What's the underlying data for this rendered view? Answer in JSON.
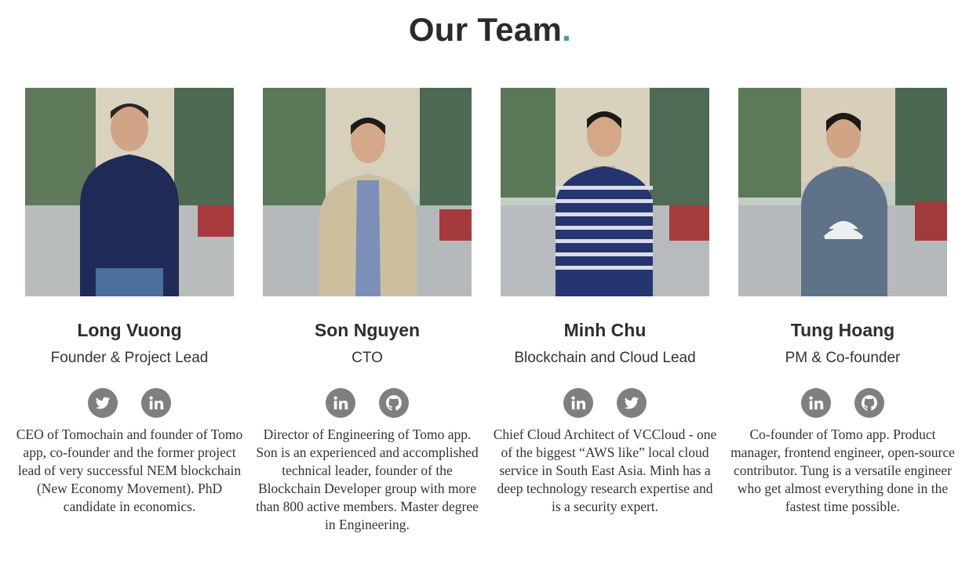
{
  "page": {
    "title": "Our Team",
    "title_dot": ".",
    "accent": "#3aa3a4"
  },
  "members": [
    {
      "name": "Long Vuong",
      "role": "Founder & Project Lead",
      "socials": [
        "twitter-icon",
        "linkedin-icon"
      ],
      "bio": "CEO of Tomochain and founder of Tomo app, co-founder and the former project lead of very successful NEM blockchain (New Economy Movement). PhD candidate in economics."
    },
    {
      "name": "Son Nguyen",
      "role": "CTO",
      "socials": [
        "linkedin-icon",
        "github-icon"
      ],
      "bio": "Director of Engineering of Tomo app. Son is an experienced and accomplished technical leader, founder of the Blockchain Developer group with more than 800 active members. Master degree in Engineering."
    },
    {
      "name": "Minh Chu",
      "role": "Blockchain and Cloud Lead",
      "socials": [
        "linkedin-icon",
        "twitter-icon"
      ],
      "bio": "Chief Cloud Architect of VCCloud - one of the biggest “AWS like” local cloud service in South East Asia. Minh has a deep technology research expertise and is a security expert."
    },
    {
      "name": "Tung Hoang",
      "role": "PM & Co-founder",
      "socials": [
        "linkedin-icon",
        "github-icon"
      ],
      "bio": "Co-founder of Tomo app. Product manager, frontend engineer, open-source contributor. Tung is a versatile engineer who get almost everything done in the fastest time possible."
    }
  ]
}
